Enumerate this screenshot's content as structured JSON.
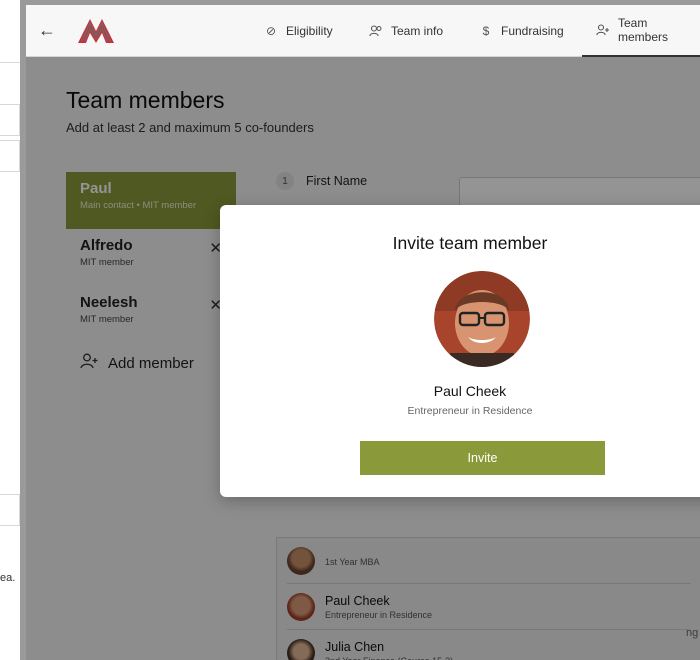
{
  "background_page": {
    "text_fragment": "ea."
  },
  "header": {
    "back_icon": "arrow-left-icon",
    "logo_icon": "av-logo",
    "tabs": [
      {
        "label": "Eligibility",
        "icon": "check-circle-icon",
        "active": false
      },
      {
        "label": "Team info",
        "icon": "users-icon",
        "active": false
      },
      {
        "label": "Fundraising",
        "icon": "dollar-icon",
        "active": false
      },
      {
        "label": "Team members",
        "icon": "user-plus-icon",
        "active": true
      }
    ]
  },
  "page": {
    "title": "Team members",
    "subtitle": "Add at least 2 and maximum 5 co-founders"
  },
  "members": [
    {
      "name": "Paul",
      "role": "Main contact • MIT member",
      "active": true,
      "removable": false
    },
    {
      "name": "Alfredo",
      "role": "MIT member",
      "active": false,
      "removable": true
    },
    {
      "name": "Neelesh",
      "role": "MIT member",
      "active": false,
      "removable": true
    }
  ],
  "add_member_label": "Add member",
  "form": {
    "field_number": "1",
    "first_name_label": "First Name"
  },
  "dropdown": {
    "items": [
      {
        "name": "",
        "role": "1st Year MBA"
      },
      {
        "name": "Paul Cheek",
        "role": "Entrepreneur in Residence"
      },
      {
        "name": "Julia Chen",
        "role": "2nd Year Finance (Course 15-3)"
      }
    ],
    "right_fragment": "ng"
  },
  "modal": {
    "title": "Invite team member",
    "name": "Paul Cheek",
    "role": "Entrepreneur in Residence",
    "invite_label": "Invite"
  },
  "colors": {
    "accent": "#8a9a3a",
    "overlay": "rgba(0,0,0,0.42)"
  }
}
